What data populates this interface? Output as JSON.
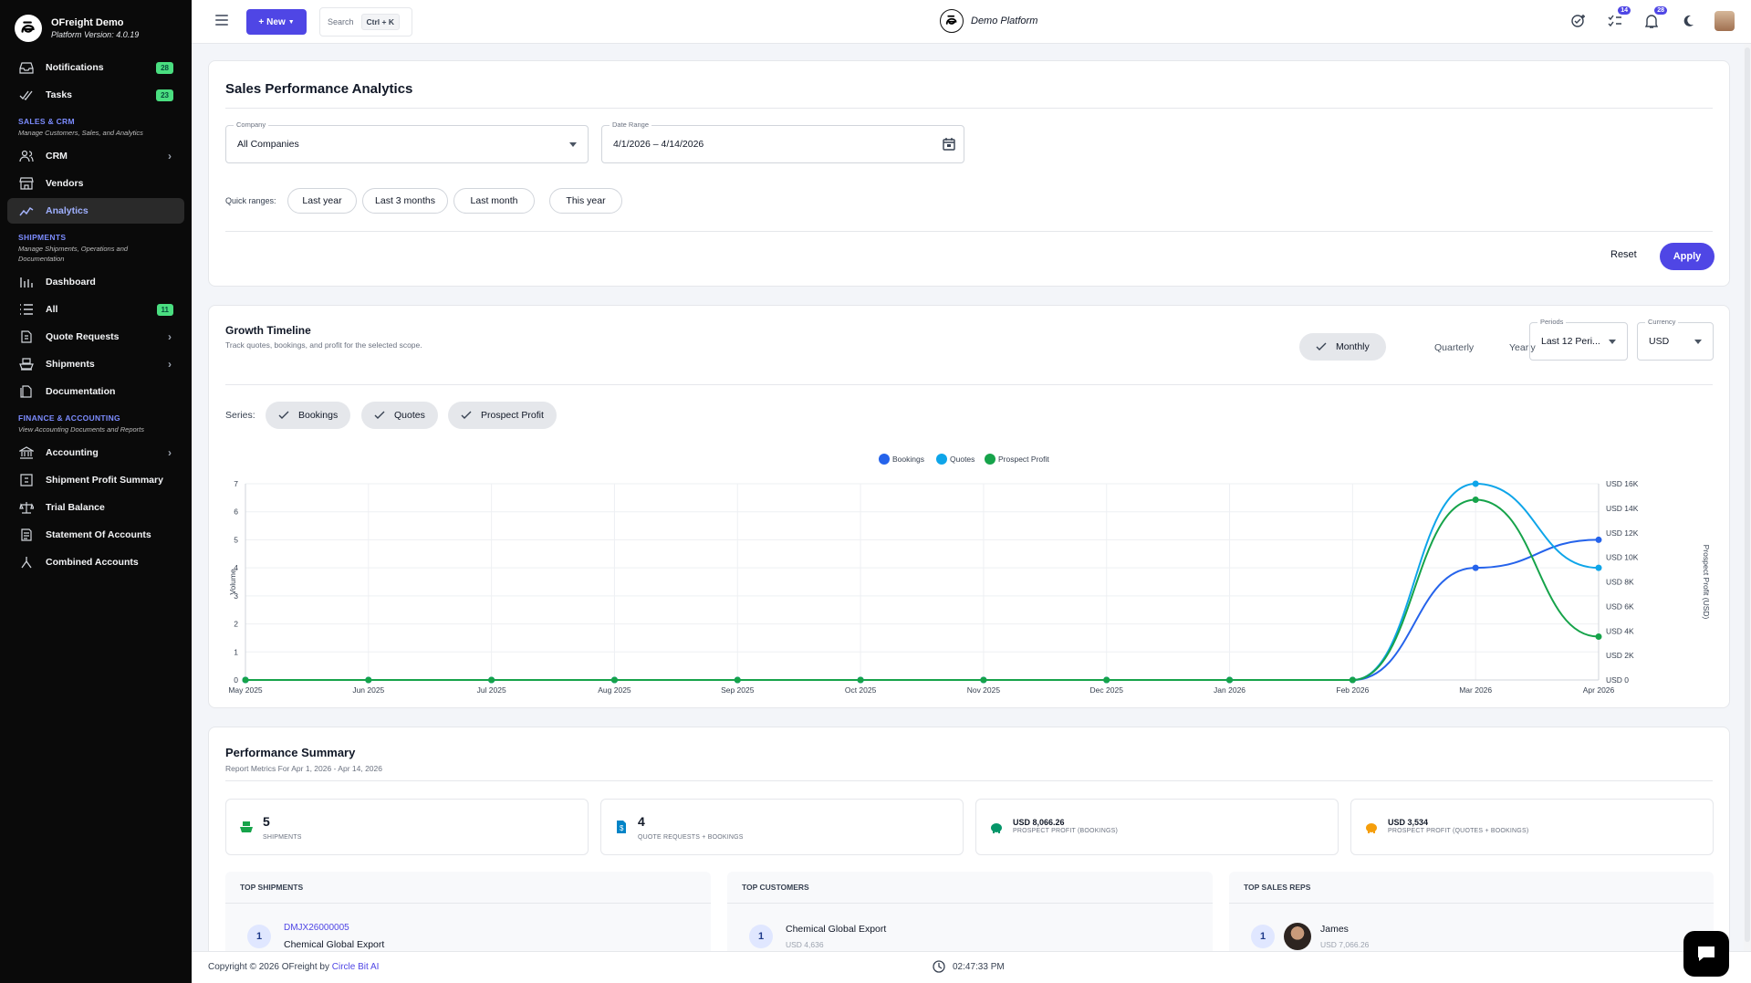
{
  "app": {
    "name": "OFreight Demo",
    "version": "Platform Version: 4.0.19",
    "platform_title": "Demo Platform"
  },
  "sidebar": {
    "top_items": [
      {
        "label": "Notifications",
        "icon": "inbox-icon",
        "badge": "28"
      },
      {
        "label": "Tasks",
        "icon": "check-double-icon",
        "badge": "23"
      }
    ],
    "sections": [
      {
        "title": "SALES & CRM",
        "subtitle": "Manage Customers, Sales, and Analytics",
        "items": [
          {
            "label": "CRM",
            "icon": "users-icon",
            "chevron": true
          },
          {
            "label": "Vendors",
            "icon": "store-icon"
          },
          {
            "label": "Analytics",
            "icon": "trend-icon",
            "active": true
          }
        ]
      },
      {
        "title": "SHIPMENTS",
        "subtitle": "Manage Shipments, Operations and Documentation",
        "items": [
          {
            "label": "Dashboard",
            "icon": "bar-chart-icon"
          },
          {
            "label": "All",
            "icon": "list-icon",
            "badge": "11"
          },
          {
            "label": "Quote Requests",
            "icon": "quote-icon",
            "chevron": true
          },
          {
            "label": "Shipments",
            "icon": "ship-icon",
            "chevron": true
          },
          {
            "label": "Documentation",
            "icon": "document-icon"
          }
        ]
      },
      {
        "title": "FINANCE & ACCOUNTING",
        "subtitle": "View Accounting Documents and Reports",
        "items": [
          {
            "label": "Accounting",
            "icon": "bank-icon",
            "chevron": true
          },
          {
            "label": "Shipment Profit Summary",
            "icon": "profit-icon"
          },
          {
            "label": "Trial Balance",
            "icon": "scale-icon"
          },
          {
            "label": "Statement Of Accounts",
            "icon": "statement-icon"
          },
          {
            "label": "Combined Accounts",
            "icon": "merge-icon"
          }
        ]
      }
    ]
  },
  "topbar": {
    "new_label": "New",
    "search_label": "Search",
    "search_shortcut": "Ctrl + K",
    "tasks_badge": "14",
    "notifications_badge": "28"
  },
  "filters": {
    "title": "Sales Performance Analytics",
    "company_label": "Company",
    "company_value": "All Companies",
    "date_label": "Date Range",
    "date_value": "4/1/2026 – 4/14/2026",
    "quick_label": "Quick ranges:",
    "quick_ranges": [
      "Last year",
      "Last 3 months",
      "Last month",
      "This year"
    ],
    "reset_label": "Reset",
    "apply_label": "Apply"
  },
  "growth": {
    "title": "Growth Timeline",
    "subtitle": "Track quotes, bookings, and profit for the selected scope.",
    "granularity": [
      "Monthly",
      "Quarterly",
      "Yearly"
    ],
    "periods_label": "Periods",
    "periods_value": "Last 12 Peri...",
    "currency_label": "Currency",
    "currency_value": "USD",
    "series_label": "Series:",
    "series_chips": [
      "Bookings",
      "Quotes",
      "Prospect Profit"
    ]
  },
  "chart_data": {
    "type": "line",
    "x": [
      "May 2025",
      "Jun 2025",
      "Jul 2025",
      "Aug 2025",
      "Sep 2025",
      "Oct 2025",
      "Nov 2025",
      "Dec 2025",
      "Jan 2026",
      "Feb 2026",
      "Mar 2026",
      "Apr 2026"
    ],
    "ylabel": "Volume",
    "y2label": "Prospect Profit (USD)",
    "ylim": [
      0,
      7
    ],
    "y_ticks": [
      "0",
      "1",
      "2",
      "3",
      "4",
      "5",
      "6",
      "7"
    ],
    "y2lim": [
      0,
      16000
    ],
    "y2_ticks": [
      "USD 0",
      "USD 2K",
      "USD 4K",
      "USD 6K",
      "USD 8K",
      "USD 10K",
      "USD 12K",
      "USD 14K",
      "USD 16K"
    ],
    "legend_position": "top-center",
    "grid": true,
    "series": [
      {
        "name": "Bookings",
        "axis": "left",
        "color": "#2563eb",
        "values": [
          0,
          0,
          0,
          0,
          0,
          0,
          0,
          0,
          0,
          0,
          4,
          5
        ]
      },
      {
        "name": "Quotes",
        "axis": "left",
        "color": "#0ea5e9",
        "values": [
          0,
          0,
          0,
          0,
          0,
          0,
          0,
          0,
          0,
          0,
          7,
          4
        ]
      },
      {
        "name": "Prospect Profit",
        "axis": "right",
        "color": "#16a34a",
        "values": [
          0,
          0,
          0,
          0,
          0,
          0,
          0,
          0,
          0,
          0,
          14700,
          3534
        ]
      }
    ]
  },
  "summary": {
    "title": "Performance Summary",
    "subtitle": "Report Metrics For Apr 1, 2026 - Apr 14, 2026",
    "stats": [
      {
        "value": "5",
        "label": "SHIPMENTS",
        "icon": "ship-icon",
        "color": "#16a34a"
      },
      {
        "value": "4",
        "label": "QUOTE REQUESTS + BOOKINGS",
        "icon": "quote-doc-icon",
        "color": "#0284c7"
      },
      {
        "value": "USD 8,066.26",
        "label": "PROSPECT PROFIT (BOOKINGS)",
        "icon": "piggy-bank-icon",
        "color": "#059669"
      },
      {
        "value": "USD 3,534",
        "label": "PROSPECT PROFIT (QUOTES + BOOKINGS)",
        "icon": "piggy-bank-icon",
        "color": "#f59e0b"
      }
    ],
    "top_shipments": {
      "title": "TOP SHIPMENTS",
      "rank": "1",
      "id": "DMJX26000005",
      "customer": "Chemical Global Export"
    },
    "top_customers": {
      "title": "TOP CUSTOMERS",
      "rank": "1",
      "name": "Chemical Global Export",
      "amount": "USD 4,636"
    },
    "top_reps": {
      "title": "TOP SALES REPS",
      "rank": "1",
      "name": "James",
      "amount": "USD 7,066.26"
    }
  },
  "footer": {
    "copyright": "Copyright © 2026 OFreight by",
    "company": "Circle Bit AI",
    "time": "02:47:33 PM"
  },
  "colors": {
    "accent": "#4f46e5",
    "sidebar_bg": "#0a0a0a",
    "badge_green": "#4ade80"
  }
}
